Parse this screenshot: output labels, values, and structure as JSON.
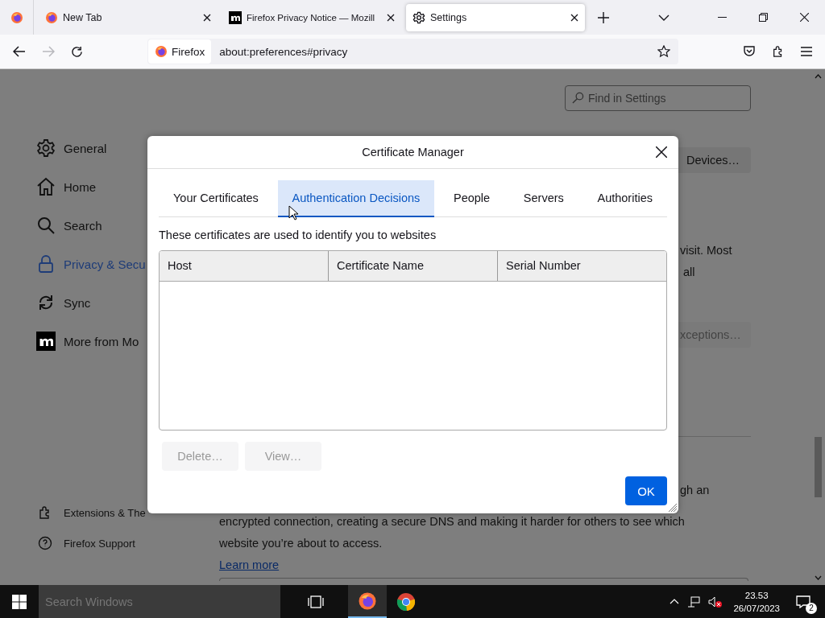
{
  "tabs": [
    {
      "kind": "firefox",
      "title": "New Tab",
      "selected": false
    },
    {
      "kind": "mozilla",
      "title": "Firefox Privacy Notice — Mozill",
      "selected": false
    },
    {
      "kind": "gear",
      "title": "Settings",
      "selected": true
    }
  ],
  "toolbar": {
    "identity": "Firefox",
    "url": "about:preferences#privacy"
  },
  "settings": {
    "search": {
      "placeholder": "Find in Settings"
    },
    "nav": [
      {
        "kind": "gear",
        "label": "General",
        "selected": false
      },
      {
        "kind": "home",
        "label": "Home",
        "selected": false
      },
      {
        "kind": "search",
        "label": "Search",
        "selected": false
      },
      {
        "kind": "lock",
        "label": "Privacy & Secu",
        "selected": true
      },
      {
        "kind": "sync",
        "label": "Sync",
        "selected": false
      },
      {
        "kind": "mozilla",
        "label": "More from Mo",
        "selected": false
      }
    ],
    "footer": [
      {
        "kind": "puzzle",
        "label": "Extensions & The"
      },
      {
        "kind": "help",
        "label": "Firefox Support"
      }
    ],
    "devices_button": "Devices…",
    "text_1": "visit. Most",
    "text_2": "all",
    "exceptions_button": "xceptions…",
    "text_3": "gh an",
    "paragraph_lines": [
      "encrypted connection, creating a secure DNS and making it harder for others to see which",
      "website you’re about to access."
    ],
    "learn_more": "Learn more"
  },
  "dialog": {
    "title": "Certificate Manager",
    "tabs": [
      {
        "label": "Your Certificates",
        "selected": false
      },
      {
        "label": "Authentication Decisions",
        "selected": true
      },
      {
        "label": "People",
        "selected": false
      },
      {
        "label": "Servers",
        "selected": false
      },
      {
        "label": "Authorities",
        "selected": false
      }
    ],
    "description": "These certificates are used to identify you to websites",
    "columns": [
      "Host",
      "Certificate Name",
      "Serial Number"
    ],
    "buttons": [
      {
        "label": "Delete…",
        "disabled": true
      },
      {
        "label": "View…",
        "disabled": true
      }
    ],
    "ok": "OK"
  },
  "taskbar": {
    "search_placeholder": "Search Windows",
    "apps": [
      {
        "kind": "firefox",
        "selected": true
      },
      {
        "kind": "chrome",
        "selected": false
      }
    ],
    "time": "23.53",
    "date": "26/07/2023",
    "notifications": "2"
  }
}
